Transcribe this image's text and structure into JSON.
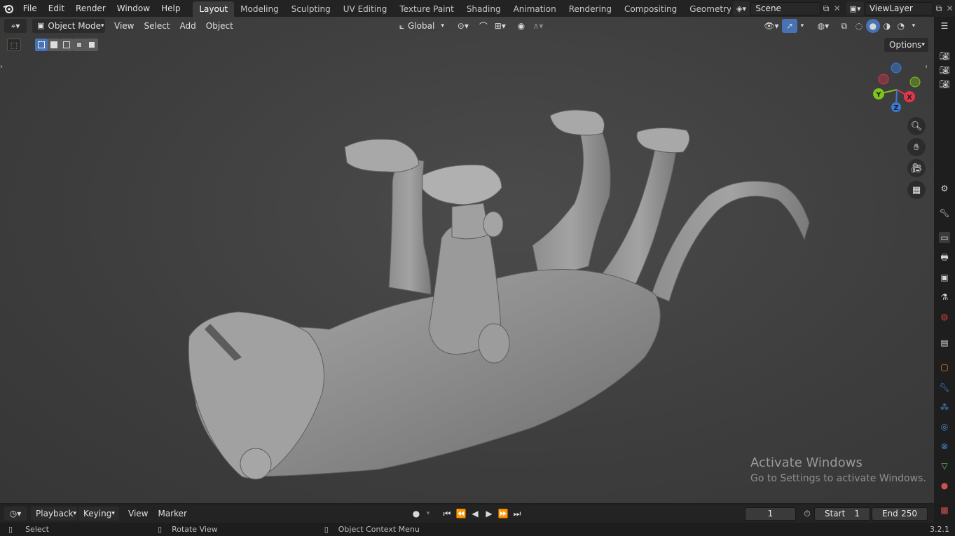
{
  "menubar": {
    "items": [
      "File",
      "Edit",
      "Render",
      "Window",
      "Help"
    ]
  },
  "workspaces": {
    "tabs": [
      "Layout",
      "Modeling",
      "Sculpting",
      "UV Editing",
      "Texture Paint",
      "Shading",
      "Animation",
      "Rendering",
      "Compositing",
      "Geometry Noc"
    ],
    "active": "Layout"
  },
  "scene": {
    "label": "Scene"
  },
  "view_layer": {
    "label": "ViewLayer"
  },
  "viewport_header": {
    "mode": "Object Mode",
    "menus": [
      "View",
      "Select",
      "Add",
      "Object"
    ],
    "orientation": "Global",
    "options_label": "Options"
  },
  "gizmo": {
    "x": "X",
    "y": "Y",
    "z": "Z"
  },
  "timeline": {
    "menus": [
      "Playback",
      "Keying",
      "View",
      "Marker"
    ],
    "current_frame": "1",
    "start_label": "Start",
    "start_value": "1",
    "end_label": "End",
    "end_value": "250"
  },
  "statusbar": {
    "select": "Select",
    "rotate": "Rotate View",
    "context": "Object Context Menu",
    "version": "3.2.1"
  },
  "watermark": {
    "title": "Activate Windows",
    "subtitle": "Go to Settings to activate Windows."
  },
  "colors": {
    "accent": "#4772b3",
    "axis_x": "#e5344d",
    "axis_y": "#7ec41b",
    "axis_z": "#3a7ad6"
  }
}
